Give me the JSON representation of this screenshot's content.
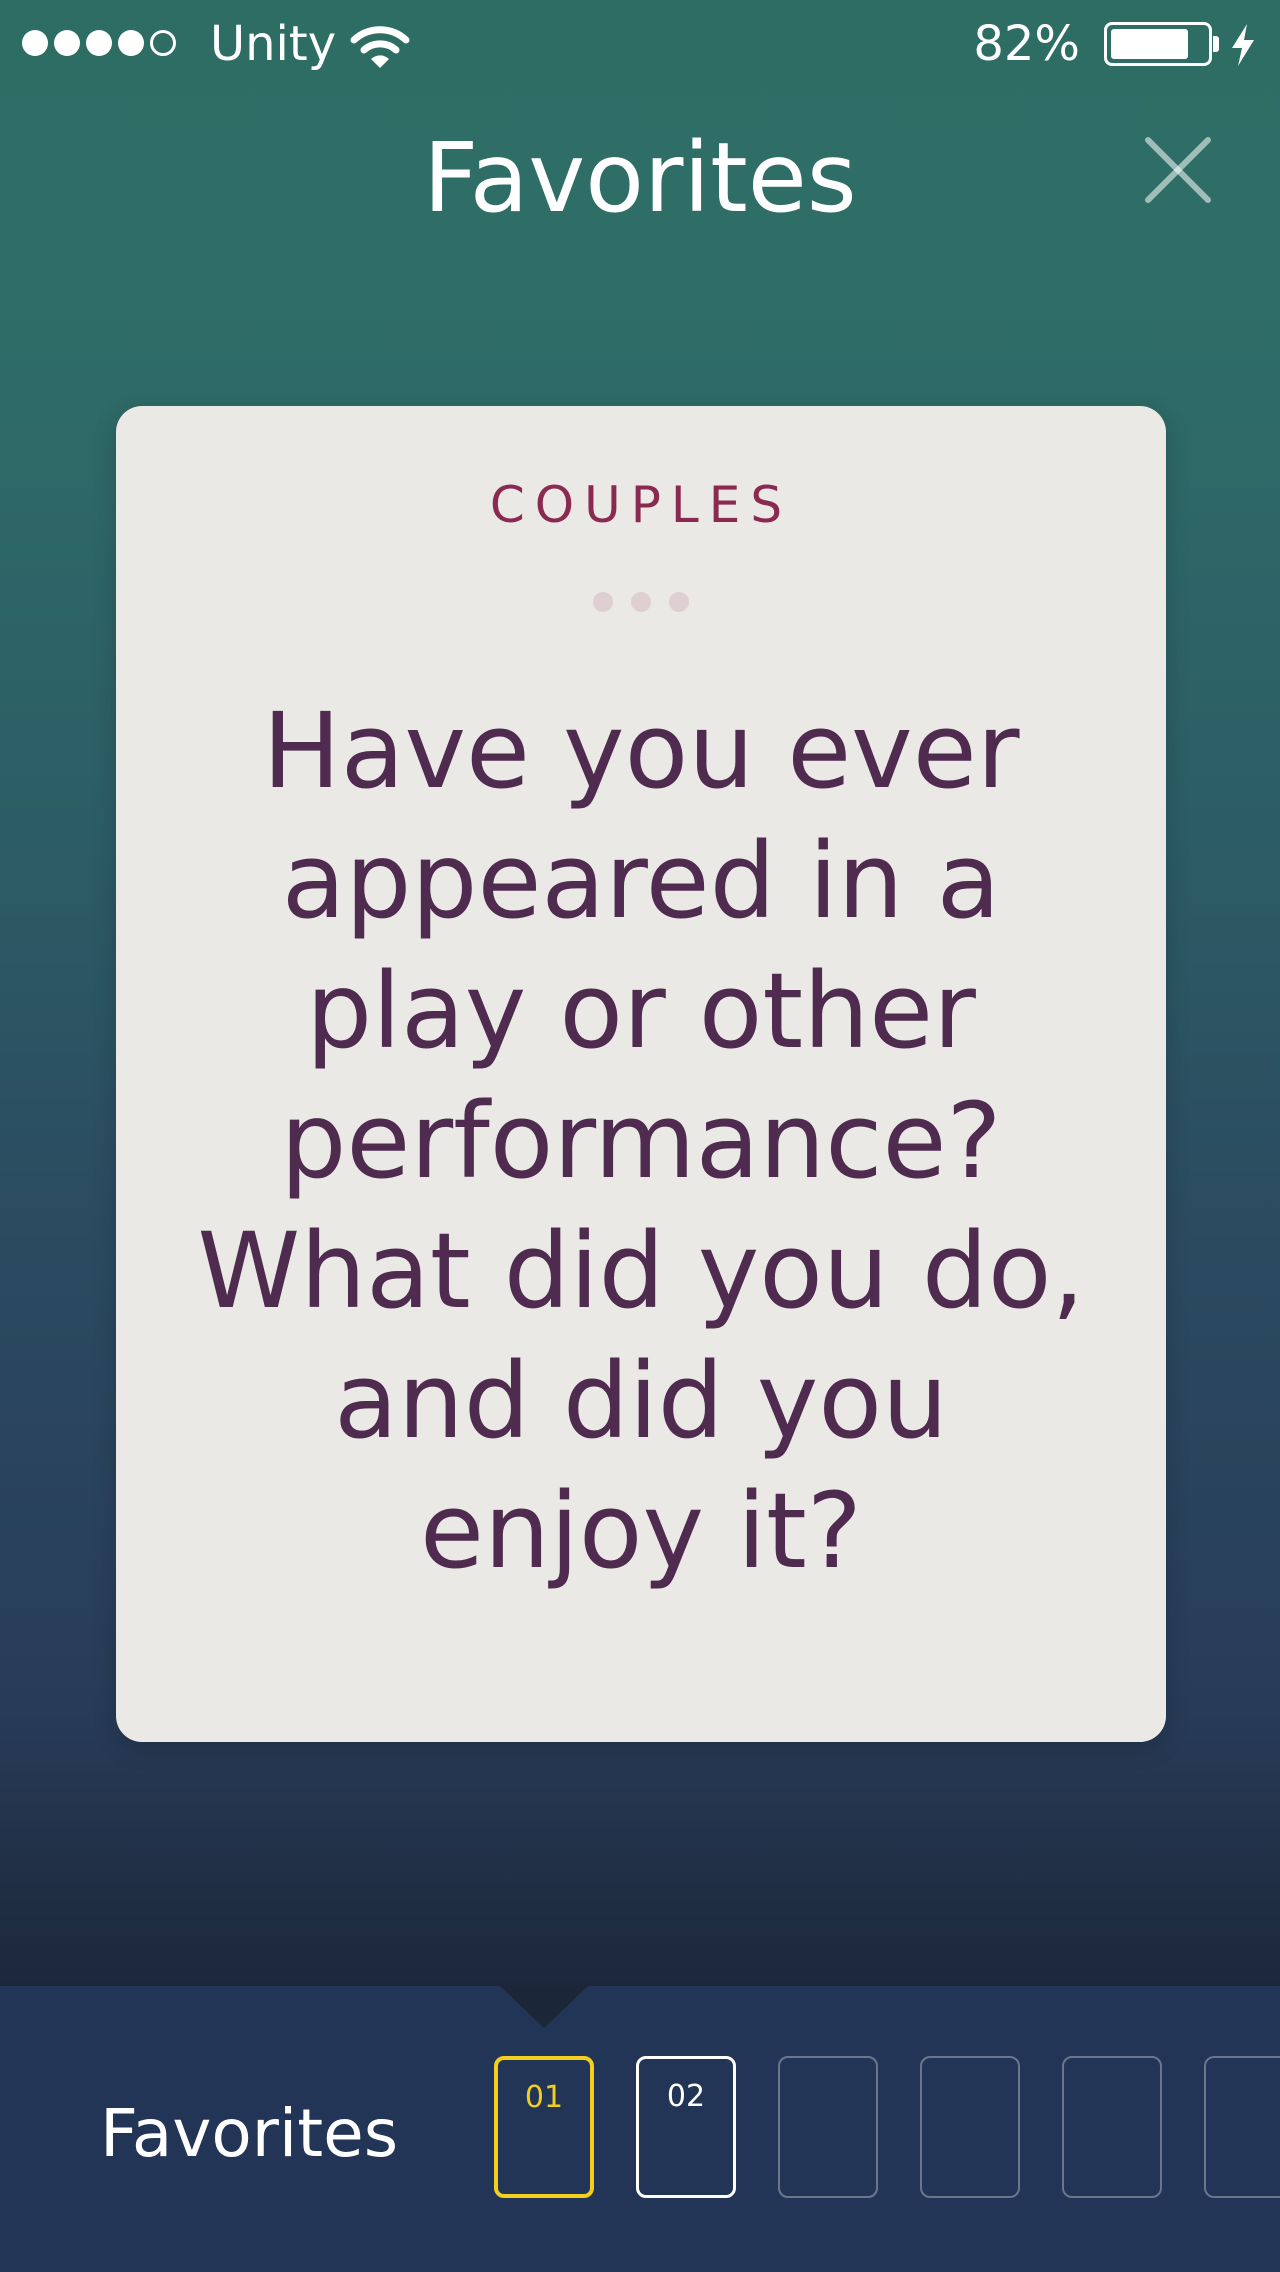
{
  "status_bar": {
    "carrier": "Unity",
    "battery_percent": "82%",
    "battery_level": 0.82,
    "signal_bars_filled": 4,
    "signal_bars_total": 5
  },
  "header": {
    "title": "Favorites",
    "close_icon": "close-icon"
  },
  "card": {
    "category": "COUPLES",
    "question": "Have you ever appeared in a play or other performance? What did you do, and did you enjoy it?"
  },
  "tray": {
    "label": "Favorites",
    "slots": [
      {
        "number": "01",
        "state": "active"
      },
      {
        "number": "02",
        "state": "filled"
      },
      {
        "number": "",
        "state": "empty"
      },
      {
        "number": "",
        "state": "empty"
      },
      {
        "number": "",
        "state": "empty"
      },
      {
        "number": "",
        "state": "empty"
      }
    ]
  },
  "colors": {
    "accent_active_slot": "#f2cf1f",
    "card_text": "#4e2b4f",
    "category_text": "#8a2a50",
    "card_background": "#ebe9e6",
    "tray_background": "#233556"
  }
}
